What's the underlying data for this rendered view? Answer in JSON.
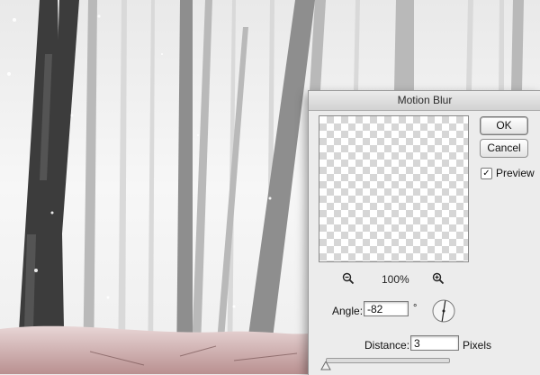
{
  "dialog": {
    "title": "Motion Blur",
    "ok_label": "OK",
    "cancel_label": "Cancel",
    "preview_label": "Preview",
    "preview_checked": true,
    "zoom_value": "100%",
    "angle_label": "Angle:",
    "angle_value": "-82",
    "angle_unit": "°",
    "distance_label": "Distance:",
    "distance_value": "3",
    "distance_unit": "Pixels"
  },
  "icons": {
    "zoom_out": "zoom-out-icon",
    "zoom_in": "zoom-in-icon",
    "angle_dial": "angle-dial-icon",
    "slider_thumb": "slider-thumb-icon"
  },
  "colors": {
    "dialog_bg": "#ececec",
    "fog": "#f2f2f2",
    "tree_bark": "#3a3a3a",
    "forest_floor": "#c9a6a6"
  }
}
